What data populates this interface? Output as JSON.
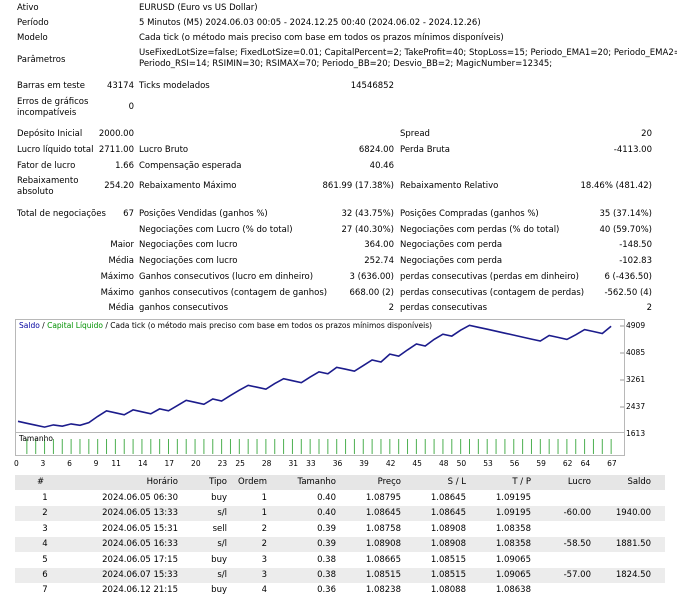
{
  "settings": {
    "rows": [
      {
        "label": "Ativo",
        "value": "EURUSD (Euro vs US Dollar)"
      },
      {
        "label": "Período",
        "value": "5 Minutos (M5) 2024.06.03 00:05 - 2024.12.25 00:40 (2024.06.02 - 2024.12.26)"
      },
      {
        "label": "Modelo",
        "value": "Cada tick (o método mais preciso com base em todos os prazos mínimos disponíveis)"
      },
      {
        "label": "Parâmetros",
        "value_line1": "UseFixedLotSize=false; FixedLotSize=0.01; CapitalPercent=2; TakeProfit=40; StopLoss=15; Periodo_EMA1=20; Periodo_EMA2=55;",
        "value_line2": "Periodo_RSI=14; RSIMIN=30; RSIMAX=70; Periodo_BB=20; Desvio_BB=2; MagicNumber=12345;"
      }
    ],
    "bars_label": "Barras em teste",
    "bars_value": "43174",
    "ticks_label": "Ticks modelados",
    "ticks_value": "14546852",
    "errors_label_1": "Erros de gráficos",
    "errors_label_2": "incompatíveis",
    "errors_value": "0"
  },
  "results": {
    "deposit_label": "Depósito Inicial",
    "deposit_value": "2000.00",
    "spread_label": "Spread",
    "spread_value": "20",
    "net_label": "Lucro líquido total",
    "net_value": "2711.00",
    "gross_profit_label": "Lucro Bruto",
    "gross_profit_value": "6824.00",
    "gross_loss_label": "Perda Bruta",
    "gross_loss_value": "-4113.00",
    "pf_label": "Fator de lucro",
    "pf_value": "1.66",
    "expected_label": "Compensação esperada",
    "expected_value": "40.46",
    "abs_dd_label_1": "Rebaixamento",
    "abs_dd_label_2": "absoluto",
    "abs_dd_value": "254.20",
    "max_dd_label": "Rebaixamento Máximo",
    "max_dd_value": "861.99 (17.38%)",
    "rel_dd_label": "Rebaixamento Relativo",
    "rel_dd_value": "18.46% (481.42)",
    "total_trades_label": "Total de negociações",
    "total_trades_value": "67",
    "short_label": "Posições Vendidas (ganhos %)",
    "short_value": "32 (43.75%)",
    "long_label": "Posições Compradas (ganhos %)",
    "long_value": "35 (37.14%)",
    "profit_trades_label": "Negociações com Lucro (% do total)",
    "profit_trades_value": "27 (40.30%)",
    "loss_trades_label": "Negociações com perdas (% do total)",
    "loss_trades_value": "40 (59.70%)",
    "largest_prefix": "Maior",
    "largest_profit_label": "Negociações com lucro",
    "largest_profit_value": "364.00",
    "largest_loss_label": "Negociações com perda",
    "largest_loss_value": "-148.50",
    "avg_prefix": "Média",
    "avg_profit_label": "Negociações com lucro",
    "avg_profit_value": "252.74",
    "avg_loss_label": "Negociações com perda",
    "avg_loss_value": "-102.83",
    "max_prefix": "Máximo",
    "max_cons_wins_label": "Ganhos consecutivos (lucro em dinheiro)",
    "max_cons_wins_value": "3 (636.00)",
    "max_cons_losses_label": "perdas consecutivas (perdas em dinheiro)",
    "max_cons_losses_value": "6 (-436.50)",
    "max2_prefix": "Máximo",
    "max_cons_profit_label": "ganhos consecutivos (contagem de ganhos)",
    "max_cons_profit_value": "668.00 (2)",
    "max_cons_loss_label": "perdas consecutivas (contagem de perdas)",
    "max_cons_loss_value": "-562.50 (4)",
    "avg2_prefix": "Média",
    "avg_cons_wins_label": "ganhos consecutivos",
    "avg_cons_wins_value": "2",
    "avg_cons_losses_label": "perdas consecutivas",
    "avg_cons_losses_value": "2"
  },
  "chart_header": {
    "balance": "Saldo",
    "sep": " / ",
    "equity": "Capital Líquido",
    "rest": " / Cada tick (o método mais preciso com base em todos os prazos mínimos disponíveis)"
  },
  "volume_label": "Tamanho",
  "chart_data": {
    "type": "line",
    "series": [
      {
        "name": "Saldo",
        "color": "#1c1c8c",
        "x": [
          0,
          1,
          2,
          3,
          4,
          5,
          6,
          7,
          8,
          9,
          10,
          11,
          12,
          13,
          14,
          15,
          16,
          17,
          18,
          19,
          20,
          21,
          22,
          23,
          24,
          25,
          26,
          27,
          28,
          29,
          30,
          31,
          32,
          33,
          34,
          35,
          36,
          37,
          38,
          39,
          40,
          41,
          42,
          43,
          44,
          45,
          46,
          47,
          48,
          49,
          50,
          51,
          52,
          53,
          54,
          55,
          56,
          57,
          58,
          59,
          60,
          61,
          62,
          63,
          64,
          65,
          66,
          67
        ],
        "values": [
          2000,
          1940,
          1882,
          1825,
          1890,
          1850,
          1920,
          1880,
          1960,
          2150,
          2320,
          2260,
          2200,
          2350,
          2290,
          2230,
          2380,
          2320,
          2480,
          2640,
          2580,
          2520,
          2680,
          2620,
          2790,
          2950,
          3100,
          3040,
          2980,
          3150,
          3300,
          3240,
          3180,
          3350,
          3510,
          3450,
          3650,
          3590,
          3530,
          3700,
          3870,
          3810,
          4050,
          3990,
          4180,
          4360,
          4300,
          4500,
          4660,
          4600,
          4780,
          4930,
          4870,
          4810,
          4750,
          4690,
          4630,
          4570,
          4510,
          4450,
          4620,
          4560,
          4500,
          4640,
          4800,
          4740,
          4680,
          4900
        ]
      }
    ],
    "y_ticks": [
      "4909",
      "4085",
      "3261",
      "2437",
      "1613"
    ],
    "ylim": [
      1613,
      4909
    ],
    "x_ticks": [
      "0",
      "3",
      "6",
      "9",
      "11",
      "14",
      "17",
      "20",
      "23",
      "25",
      "28",
      "31",
      "33",
      "36",
      "39",
      "42",
      "45",
      "48",
      "50",
      "53",
      "56",
      "59",
      "62",
      "64",
      "67"
    ],
    "xlim": [
      0,
      68
    ]
  },
  "table": {
    "headers": [
      "#",
      "Horário",
      "Tipo",
      "Ordem",
      "Tamanho",
      "Preço",
      "S / L",
      "T / P",
      "Lucro",
      "Saldo"
    ],
    "rows": [
      [
        "1",
        "2024.06.05 06:30",
        "buy",
        "1",
        "0.40",
        "1.08795",
        "1.08645",
        "1.09195",
        "",
        ""
      ],
      [
        "2",
        "2024.06.05 13:33",
        "s/l",
        "1",
        "0.40",
        "1.08645",
        "1.08645",
        "1.09195",
        "-60.00",
        "1940.00"
      ],
      [
        "3",
        "2024.06.05 15:31",
        "sell",
        "2",
        "0.39",
        "1.08758",
        "1.08908",
        "1.08358",
        "",
        ""
      ],
      [
        "4",
        "2024.06.05 16:33",
        "s/l",
        "2",
        "0.39",
        "1.08908",
        "1.08908",
        "1.08358",
        "-58.50",
        "1881.50"
      ],
      [
        "5",
        "2024.06.05 17:15",
        "buy",
        "3",
        "0.38",
        "1.08665",
        "1.08515",
        "1.09065",
        "",
        ""
      ],
      [
        "6",
        "2024.06.07 15:33",
        "s/l",
        "3",
        "0.38",
        "1.08515",
        "1.08515",
        "1.09065",
        "-57.00",
        "1824.50"
      ],
      [
        "7",
        "2024.06.12 21:15",
        "buy",
        "4",
        "0.36",
        "1.08238",
        "1.08088",
        "1.08638",
        "",
        ""
      ]
    ]
  }
}
